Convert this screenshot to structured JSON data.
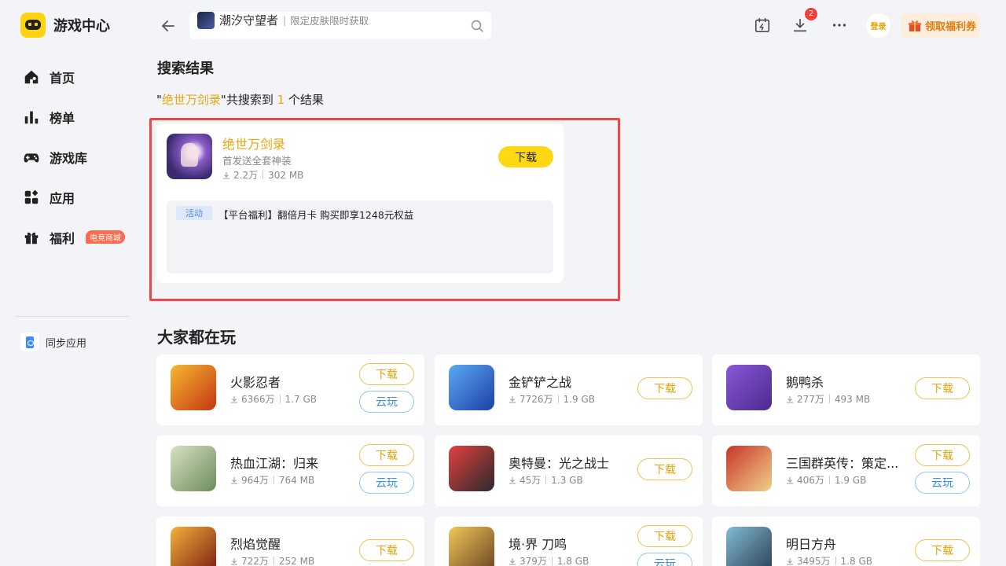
{
  "app": {
    "title": "游戏中心"
  },
  "sidebar": {
    "items": [
      {
        "label": "首页",
        "icon": "home-icon"
      },
      {
        "label": "榜单",
        "icon": "ranking-icon"
      },
      {
        "label": "游戏库",
        "icon": "gamepad-icon"
      },
      {
        "label": "应用",
        "icon": "apps-icon"
      },
      {
        "label": "福利",
        "icon": "gift-icon",
        "badge": "电竞商城"
      }
    ],
    "sync": {
      "label": "同步应用"
    }
  },
  "topbar": {
    "search": {
      "title": "潮汐守望者",
      "separator": "|",
      "hint": "限定皮肤限时获取"
    },
    "download_badge": "2",
    "login_label": "登录",
    "coupon_label": "领取福利券"
  },
  "results": {
    "section_title": "搜索结果",
    "summary": {
      "quote_open": "\"",
      "keyword": "绝世万剑录",
      "middle": "\"共搜索到 ",
      "count": "1",
      "end": " 个结果"
    },
    "card": {
      "name": "绝世万剑录",
      "desc": "首发送全套神装",
      "downloads": "2.2万",
      "size": "302 MB",
      "button": "下载",
      "activity_tag": "活动",
      "activity_text": "【平台福利】翻倍月卡 购买即享1248元权益"
    }
  },
  "popular": {
    "section_title": "大家都在玩",
    "games": [
      {
        "name": "火影忍者",
        "downloads": "6366万",
        "size": "1.7 GB",
        "buttons": [
          "下载",
          "云玩"
        ]
      },
      {
        "name": "金铲铲之战",
        "downloads": "7726万",
        "size": "1.9 GB",
        "buttons": [
          "下载"
        ]
      },
      {
        "name": "鹅鸭杀",
        "downloads": "277万",
        "size": "493 MB",
        "buttons": [
          "下载"
        ]
      },
      {
        "name": "热血江湖：归来",
        "downloads": "964万",
        "size": "764 MB",
        "buttons": [
          "下载",
          "云玩"
        ]
      },
      {
        "name": "奥特曼：光之战士",
        "downloads": "45万",
        "size": "1.3 GB",
        "buttons": [
          "下载"
        ]
      },
      {
        "name": "三国群英传：策定...",
        "downloads": "406万",
        "size": "1.9 GB",
        "buttons": [
          "下载",
          "云玩"
        ]
      },
      {
        "name": "烈焰觉醒",
        "downloads": "722万",
        "size": "252 MB",
        "buttons": [
          "下载"
        ]
      },
      {
        "name": "境·界 刀鸣",
        "downloads": "379万",
        "size": "1.8 GB",
        "buttons": [
          "下载",
          "云玩"
        ]
      },
      {
        "name": "明日方舟",
        "downloads": "3495万",
        "size": "1.8 GB",
        "buttons": [
          "下载"
        ]
      }
    ]
  },
  "colors": {
    "accent": "#ffd814",
    "highlight_text": "#e9a60c",
    "frame_red": "#e84a4a",
    "cloud_blue": "#3a8fe0"
  }
}
